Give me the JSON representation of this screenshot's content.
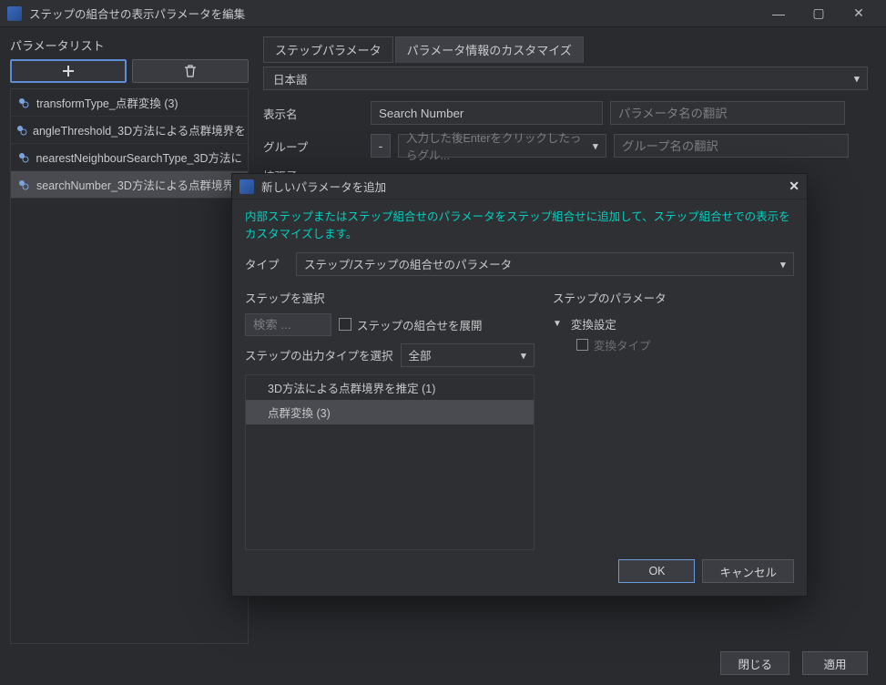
{
  "titlebar": {
    "title": "ステップの組合せの表示パラメータを編集"
  },
  "left": {
    "heading": "パラメータリスト",
    "items": [
      "transformType_点群変換 (3)",
      "angleThreshold_3D方法による点群境界を",
      "nearestNeighbourSearchType_3D方法に",
      "searchNumber_3D方法による点群境界"
    ]
  },
  "right": {
    "tabs": {
      "step_params": "ステップパラメータ",
      "custom_info": "パラメータ情報のカスタマイズ"
    },
    "language": "日本語",
    "labels": {
      "display_name": "表示名",
      "group": "グループ",
      "extension": "拡張子"
    },
    "values": {
      "display_name": "Search Number"
    },
    "placeholders": {
      "display_name_trans": "パラメータ名の翻訳",
      "group_value": "入力した後Enterをクリックしたっらグル...",
      "group_trans": "グループ名の翻訳"
    },
    "group_minus": "-"
  },
  "dialog": {
    "title": "新しいパラメータを追加",
    "desc": "内部ステップまたはステップ組合せのパラメータをステップ組合せに追加して、ステップ組合せでの表示をカスタマイズします。",
    "type_label": "タイプ",
    "type_value": "ステップ/ステップの組合せのパラメータ",
    "left": {
      "heading": "ステップを選択",
      "search_placeholder": "検索 ...",
      "expand_label": "ステップの組合せを展開",
      "output_label": "ステップの出力タイプを選択",
      "output_value": "全部",
      "steps": [
        "3D方法による点群境界を推定 (1)",
        "点群変換 (3)"
      ]
    },
    "right": {
      "heading": "ステップのパラメータ",
      "group_name": "変換設定",
      "param_name": "変換タイプ"
    },
    "buttons": {
      "ok": "OK",
      "cancel": "キャンセル"
    }
  },
  "footer": {
    "close": "閉じる",
    "apply": "適用"
  }
}
